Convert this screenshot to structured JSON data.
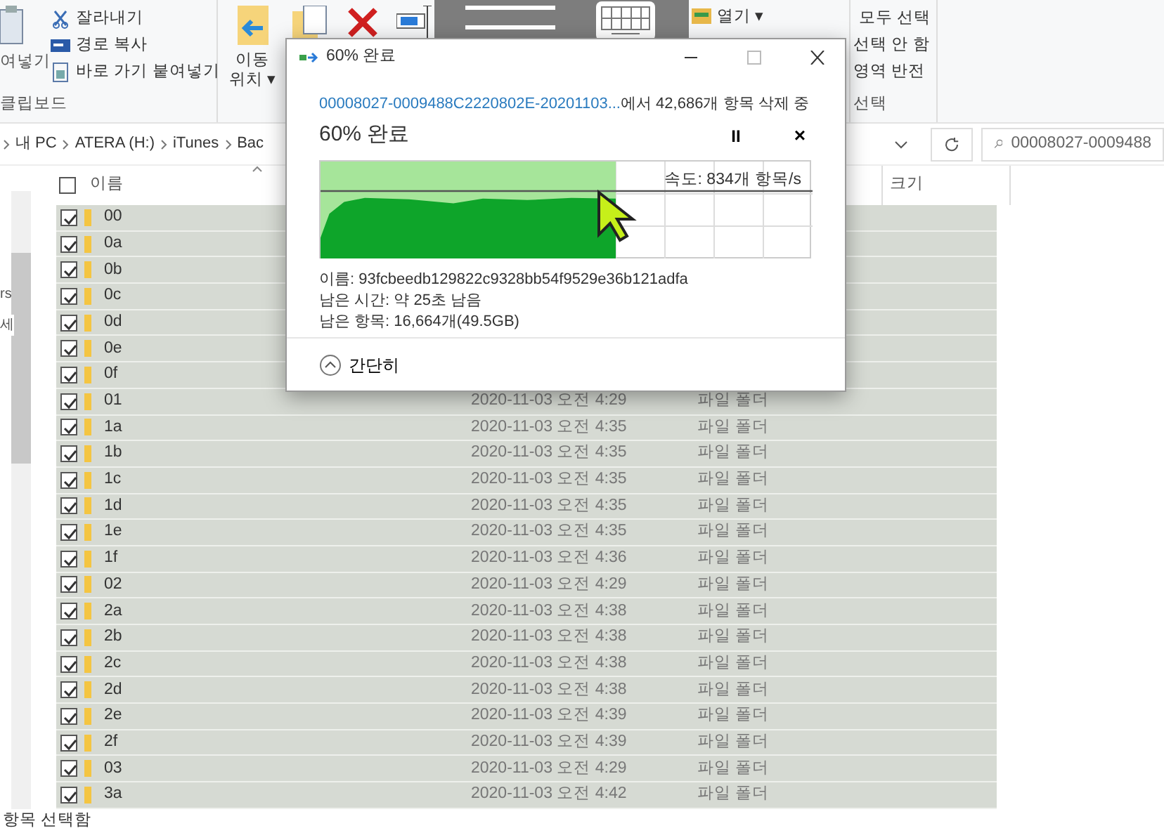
{
  "ribbon": {
    "clipboard": {
      "paste_label": "여넣기",
      "items": [
        "잘라내기",
        "경로 복사",
        "바로 가기 붙여넣기"
      ],
      "group_label": "클립보드"
    },
    "organize": {
      "move_label": [
        "이동",
        "위치 ▾"
      ]
    },
    "open": {
      "label": "열기 ▾"
    },
    "select": {
      "items": [
        "모두 선택",
        "선택 안 함",
        "영역 반전"
      ],
      "group_label": "선택"
    }
  },
  "address": {
    "breadcrumb": [
      "내 PC",
      "ATERA (H:)",
      "iTunes",
      "Bac"
    ],
    "search_value": "00008027-0009488"
  },
  "nav_pane": {
    "texts": [
      "rs",
      "세"
    ]
  },
  "columns": [
    {
      "label": "이름"
    },
    {
      "label": "크기"
    }
  ],
  "header_checked": false,
  "rows": [
    {
      "name": "00",
      "checked": true
    },
    {
      "name": "0a",
      "checked": true
    },
    {
      "name": "0b",
      "checked": true
    },
    {
      "name": "0c",
      "checked": true
    },
    {
      "name": "0d",
      "checked": true
    },
    {
      "name": "0e",
      "checked": true
    },
    {
      "name": "0f",
      "checked": true
    },
    {
      "name": "01",
      "date": "2020-11-03 오전 4:29",
      "type": "파일 폴더",
      "checked": true
    },
    {
      "name": "1a",
      "date": "2020-11-03 오전 4:35",
      "type": "파일 폴더",
      "checked": true
    },
    {
      "name": "1b",
      "date": "2020-11-03 오전 4:35",
      "type": "파일 폴더",
      "checked": true
    },
    {
      "name": "1c",
      "date": "2020-11-03 오전 4:35",
      "type": "파일 폴더",
      "checked": true
    },
    {
      "name": "1d",
      "date": "2020-11-03 오전 4:35",
      "type": "파일 폴더",
      "checked": true
    },
    {
      "name": "1e",
      "date": "2020-11-03 오전 4:35",
      "type": "파일 폴더",
      "checked": true
    },
    {
      "name": "1f",
      "date": "2020-11-03 오전 4:36",
      "type": "파일 폴더",
      "checked": true
    },
    {
      "name": "02",
      "date": "2020-11-03 오전 4:29",
      "type": "파일 폴더",
      "checked": true
    },
    {
      "name": "2a",
      "date": "2020-11-03 오전 4:38",
      "type": "파일 폴더",
      "checked": true
    },
    {
      "name": "2b",
      "date": "2020-11-03 오전 4:38",
      "type": "파일 폴더",
      "checked": true
    },
    {
      "name": "2c",
      "date": "2020-11-03 오전 4:38",
      "type": "파일 폴더",
      "checked": true
    },
    {
      "name": "2d",
      "date": "2020-11-03 오전 4:38",
      "type": "파일 폴더",
      "checked": true
    },
    {
      "name": "2e",
      "date": "2020-11-03 오전 4:39",
      "type": "파일 폴더",
      "checked": true
    },
    {
      "name": "2f",
      "date": "2020-11-03 오전 4:39",
      "type": "파일 폴더",
      "checked": true
    },
    {
      "name": "03",
      "date": "2020-11-03 오전 4:29",
      "type": "파일 폴더",
      "checked": true
    },
    {
      "name": "3a",
      "date": "2020-11-03 오전 4:42",
      "type": "파일 폴더",
      "checked": true
    }
  ],
  "status_bar": "항목 선택함",
  "dialog": {
    "title": "60% 완료",
    "source_link": "00008027-0009488C2220802E-20201103...",
    "source_rest": "에서 42,686개 항목 삭제 중",
    "heading": "60% 완료",
    "pause": "II",
    "cancel": "×",
    "speed": "속도: 834개 항목/s",
    "level": 0.6,
    "details": [
      "이름: 93fcbeedb129822c9328bb54f9529e36b121adfa",
      "남은 시간: 약 25초 남음",
      "남은 항목: 16,664개(49.5GB)"
    ],
    "toggle": "간단히"
  }
}
